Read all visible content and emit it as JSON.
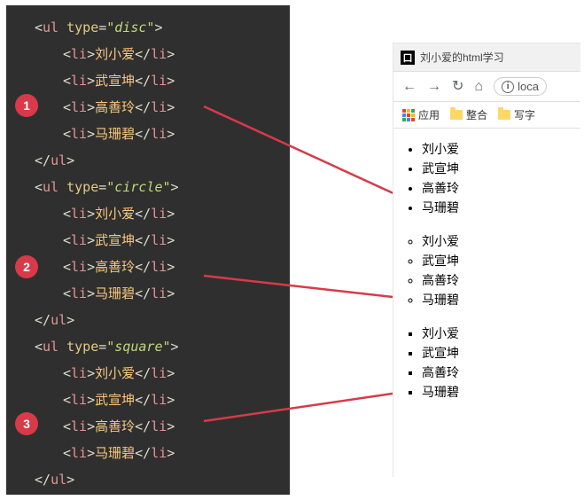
{
  "code": {
    "blocks": [
      {
        "type_attr": "disc",
        "items": [
          "刘小爱",
          "武宣坤",
          "高善玲",
          "马珊碧"
        ]
      },
      {
        "type_attr": "circle",
        "items": [
          "刘小爱",
          "武宣坤",
          "高善玲",
          "马珊碧"
        ]
      },
      {
        "type_attr": "square",
        "items": [
          "刘小爱",
          "武宣坤",
          "高善玲",
          "马珊碧"
        ]
      }
    ],
    "tag_ul": "ul",
    "tag_li": "li",
    "attr_type": "type"
  },
  "badges": [
    "1",
    "2",
    "3"
  ],
  "browser": {
    "favicon_char": "口",
    "tab_title": "刘小爱的html学习",
    "address": "loca",
    "bookmarks_apps": "应用",
    "bookmark_1": "整合",
    "bookmark_2": "写字"
  },
  "lists": [
    {
      "style": "disc",
      "items": [
        "刘小爱",
        "武宣坤",
        "高善玲",
        "马珊碧"
      ]
    },
    {
      "style": "circle",
      "items": [
        "刘小爱",
        "武宣坤",
        "高善玲",
        "马珊碧"
      ]
    },
    {
      "style": "square",
      "items": [
        "刘小爱",
        "武宣坤",
        "高善玲",
        "马珊碧"
      ]
    }
  ]
}
